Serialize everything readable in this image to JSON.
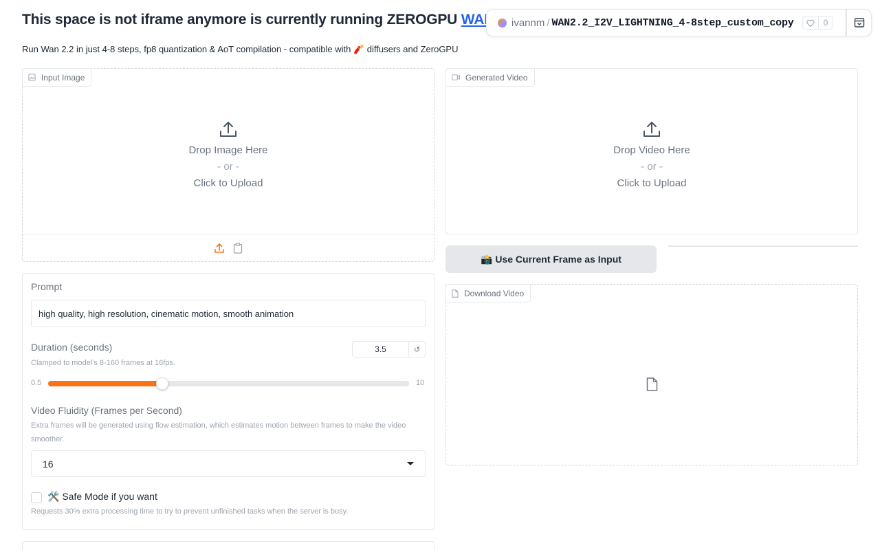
{
  "header": {
    "title_text": "This space is not iframe anymore is currently running ZEROGPU ",
    "title_link": "WAMU v",
    "subtitle_before": "Run Wan 2.2 in just 4-8 steps, fp8 quantization & AoT compilation - compatible with ",
    "subtitle_emoji": "🧨",
    "subtitle_after": " diffusers and ZeroGPU"
  },
  "hf_badge": {
    "user": "ivannm",
    "separator": "/",
    "repo": "WAN2.2_I2V_LIGHTNING_4-8step_custom_copy",
    "likes": "0"
  },
  "input_image": {
    "label": "Input Image",
    "drop_text": "Drop Image Here",
    "or_text": "- or -",
    "click_text": "Click to Upload"
  },
  "generated_video": {
    "label": "Generated Video",
    "drop_text": "Drop Video Here",
    "or_text": "- or -",
    "click_text": "Click to Upload"
  },
  "controls": {
    "prompt_label": "Prompt",
    "prompt_value": "high quality, high resolution, cinematic motion, smooth animation",
    "duration_label": "Duration (seconds)",
    "duration_info": "Clamped to model's 8-160 frames at 16fps.",
    "duration_value": "3.5",
    "duration_min": "0.5",
    "duration_max": "10",
    "duration_fraction": 0.3158,
    "fps_label": "Video Fluidity (Frames per Second)",
    "fps_info": "Extra frames will be generated using flow estimation, which estimates motion between frames to make the video smoother.",
    "fps_value": "16",
    "safe_mode_label": "🛠️ Safe Mode if you want",
    "safe_mode_info": "Requests 30% extra processing time to try to prevent unfinished tasks when the server is busy."
  },
  "use_frame_button": "📸 Use Current Frame as Input",
  "download": {
    "label": "Download Video"
  },
  "colors": {
    "accent": "#f97316",
    "link": "#2563eb"
  }
}
